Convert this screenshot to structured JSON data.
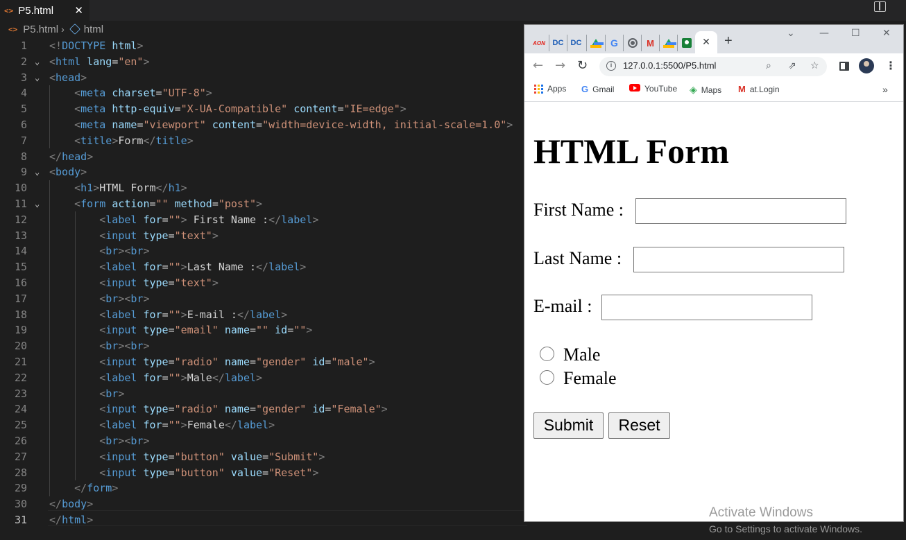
{
  "editor": {
    "tab": {
      "icon": "html-file-icon",
      "label": "P5.html",
      "close": "✕"
    },
    "breadcrumb": {
      "file": "P5.html",
      "symbol": "html"
    },
    "lines": [
      [
        [
          "brk",
          "<!"
        ],
        [
          "tag",
          "DOCTYPE"
        ],
        [
          "txt",
          " "
        ],
        [
          "att",
          "html"
        ],
        [
          "brk",
          ">"
        ]
      ],
      [
        [
          "brk",
          "<"
        ],
        [
          "tag",
          "html"
        ],
        [
          "txt",
          " "
        ],
        [
          "att",
          "lang"
        ],
        [
          "txt",
          "="
        ],
        [
          "str",
          "\"en\""
        ],
        [
          "brk",
          ">"
        ]
      ],
      [
        [
          "brk",
          "<"
        ],
        [
          "tag",
          "head"
        ],
        [
          "brk",
          ">"
        ]
      ],
      [
        [
          "txt",
          "    "
        ],
        [
          "brk",
          "<"
        ],
        [
          "tag",
          "meta"
        ],
        [
          "txt",
          " "
        ],
        [
          "att",
          "charset"
        ],
        [
          "txt",
          "="
        ],
        [
          "str",
          "\"UTF-8\""
        ],
        [
          "brk",
          ">"
        ]
      ],
      [
        [
          "txt",
          "    "
        ],
        [
          "brk",
          "<"
        ],
        [
          "tag",
          "meta"
        ],
        [
          "txt",
          " "
        ],
        [
          "att",
          "http-equiv"
        ],
        [
          "txt",
          "="
        ],
        [
          "str",
          "\"X-UA-Compatible\""
        ],
        [
          "txt",
          " "
        ],
        [
          "att",
          "content"
        ],
        [
          "txt",
          "="
        ],
        [
          "str",
          "\"IE=edge\""
        ],
        [
          "brk",
          ">"
        ]
      ],
      [
        [
          "txt",
          "    "
        ],
        [
          "brk",
          "<"
        ],
        [
          "tag",
          "meta"
        ],
        [
          "txt",
          " "
        ],
        [
          "att",
          "name"
        ],
        [
          "txt",
          "="
        ],
        [
          "str",
          "\"viewport\""
        ],
        [
          "txt",
          " "
        ],
        [
          "att",
          "content"
        ],
        [
          "txt",
          "="
        ],
        [
          "str",
          "\"width=device-width, initial-scale=1.0\""
        ],
        [
          "brk",
          ">"
        ]
      ],
      [
        [
          "txt",
          "    "
        ],
        [
          "brk",
          "<"
        ],
        [
          "tag",
          "title"
        ],
        [
          "brk",
          ">"
        ],
        [
          "txt",
          "Form"
        ],
        [
          "brk",
          "</"
        ],
        [
          "tag",
          "title"
        ],
        [
          "brk",
          ">"
        ]
      ],
      [
        [
          "brk",
          "</"
        ],
        [
          "tag",
          "head"
        ],
        [
          "brk",
          ">"
        ]
      ],
      [
        [
          "brk",
          "<"
        ],
        [
          "tag",
          "body"
        ],
        [
          "brk",
          ">"
        ]
      ],
      [
        [
          "txt",
          "    "
        ],
        [
          "brk",
          "<"
        ],
        [
          "tag",
          "h1"
        ],
        [
          "brk",
          ">"
        ],
        [
          "txt",
          "HTML Form"
        ],
        [
          "brk",
          "</"
        ],
        [
          "tag",
          "h1"
        ],
        [
          "brk",
          ">"
        ]
      ],
      [
        [
          "txt",
          "    "
        ],
        [
          "brk",
          "<"
        ],
        [
          "tag",
          "form"
        ],
        [
          "txt",
          " "
        ],
        [
          "att",
          "action"
        ],
        [
          "txt",
          "="
        ],
        [
          "str",
          "\"\""
        ],
        [
          "txt",
          " "
        ],
        [
          "att",
          "method"
        ],
        [
          "txt",
          "="
        ],
        [
          "str",
          "\"post\""
        ],
        [
          "brk",
          ">"
        ]
      ],
      [
        [
          "txt",
          "        "
        ],
        [
          "brk",
          "<"
        ],
        [
          "tag",
          "label"
        ],
        [
          "txt",
          " "
        ],
        [
          "att",
          "for"
        ],
        [
          "txt",
          "="
        ],
        [
          "str",
          "\"\""
        ],
        [
          "brk",
          ">"
        ],
        [
          "txt",
          " First Name :"
        ],
        [
          "brk",
          "</"
        ],
        [
          "tag",
          "label"
        ],
        [
          "brk",
          ">"
        ]
      ],
      [
        [
          "txt",
          "        "
        ],
        [
          "brk",
          "<"
        ],
        [
          "tag",
          "input"
        ],
        [
          "txt",
          " "
        ],
        [
          "att",
          "type"
        ],
        [
          "txt",
          "="
        ],
        [
          "str",
          "\"text\""
        ],
        [
          "brk",
          ">"
        ]
      ],
      [
        [
          "txt",
          "        "
        ],
        [
          "brk",
          "<"
        ],
        [
          "tag",
          "br"
        ],
        [
          "brk",
          "><"
        ],
        [
          "tag",
          "br"
        ],
        [
          "brk",
          ">"
        ]
      ],
      [
        [
          "txt",
          "        "
        ],
        [
          "brk",
          "<"
        ],
        [
          "tag",
          "label"
        ],
        [
          "txt",
          " "
        ],
        [
          "att",
          "for"
        ],
        [
          "txt",
          "="
        ],
        [
          "str",
          "\"\""
        ],
        [
          "brk",
          ">"
        ],
        [
          "txt",
          "Last Name :"
        ],
        [
          "brk",
          "</"
        ],
        [
          "tag",
          "label"
        ],
        [
          "brk",
          ">"
        ]
      ],
      [
        [
          "txt",
          "        "
        ],
        [
          "brk",
          "<"
        ],
        [
          "tag",
          "input"
        ],
        [
          "txt",
          " "
        ],
        [
          "att",
          "type"
        ],
        [
          "txt",
          "="
        ],
        [
          "str",
          "\"text\""
        ],
        [
          "brk",
          ">"
        ]
      ],
      [
        [
          "txt",
          "        "
        ],
        [
          "brk",
          "<"
        ],
        [
          "tag",
          "br"
        ],
        [
          "brk",
          "><"
        ],
        [
          "tag",
          "br"
        ],
        [
          "brk",
          ">"
        ]
      ],
      [
        [
          "txt",
          "        "
        ],
        [
          "brk",
          "<"
        ],
        [
          "tag",
          "label"
        ],
        [
          "txt",
          " "
        ],
        [
          "att",
          "for"
        ],
        [
          "txt",
          "="
        ],
        [
          "str",
          "\"\""
        ],
        [
          "brk",
          ">"
        ],
        [
          "txt",
          "E-mail :"
        ],
        [
          "brk",
          "</"
        ],
        [
          "tag",
          "label"
        ],
        [
          "brk",
          ">"
        ]
      ],
      [
        [
          "txt",
          "        "
        ],
        [
          "brk",
          "<"
        ],
        [
          "tag",
          "input"
        ],
        [
          "txt",
          " "
        ],
        [
          "att",
          "type"
        ],
        [
          "txt",
          "="
        ],
        [
          "str",
          "\"email\""
        ],
        [
          "txt",
          " "
        ],
        [
          "att",
          "name"
        ],
        [
          "txt",
          "="
        ],
        [
          "str",
          "\"\""
        ],
        [
          "txt",
          " "
        ],
        [
          "att",
          "id"
        ],
        [
          "txt",
          "="
        ],
        [
          "str",
          "\"\""
        ],
        [
          "brk",
          ">"
        ]
      ],
      [
        [
          "txt",
          "        "
        ],
        [
          "brk",
          "<"
        ],
        [
          "tag",
          "br"
        ],
        [
          "brk",
          "><"
        ],
        [
          "tag",
          "br"
        ],
        [
          "brk",
          ">"
        ]
      ],
      [
        [
          "txt",
          "        "
        ],
        [
          "brk",
          "<"
        ],
        [
          "tag",
          "input"
        ],
        [
          "txt",
          " "
        ],
        [
          "att",
          "type"
        ],
        [
          "txt",
          "="
        ],
        [
          "str",
          "\"radio\""
        ],
        [
          "txt",
          " "
        ],
        [
          "att",
          "name"
        ],
        [
          "txt",
          "="
        ],
        [
          "str",
          "\"gender\""
        ],
        [
          "txt",
          " "
        ],
        [
          "att",
          "id"
        ],
        [
          "txt",
          "="
        ],
        [
          "str",
          "\"male\""
        ],
        [
          "brk",
          ">"
        ]
      ],
      [
        [
          "txt",
          "        "
        ],
        [
          "brk",
          "<"
        ],
        [
          "tag",
          "label"
        ],
        [
          "txt",
          " "
        ],
        [
          "att",
          "for"
        ],
        [
          "txt",
          "="
        ],
        [
          "str",
          "\"\""
        ],
        [
          "brk",
          ">"
        ],
        [
          "txt",
          "Male"
        ],
        [
          "brk",
          "</"
        ],
        [
          "tag",
          "label"
        ],
        [
          "brk",
          ">"
        ]
      ],
      [
        [
          "txt",
          "        "
        ],
        [
          "brk",
          "<"
        ],
        [
          "tag",
          "br"
        ],
        [
          "brk",
          ">"
        ]
      ],
      [
        [
          "txt",
          "        "
        ],
        [
          "brk",
          "<"
        ],
        [
          "tag",
          "input"
        ],
        [
          "txt",
          " "
        ],
        [
          "att",
          "type"
        ],
        [
          "txt",
          "="
        ],
        [
          "str",
          "\"radio\""
        ],
        [
          "txt",
          " "
        ],
        [
          "att",
          "name"
        ],
        [
          "txt",
          "="
        ],
        [
          "str",
          "\"gender\""
        ],
        [
          "txt",
          " "
        ],
        [
          "att",
          "id"
        ],
        [
          "txt",
          "="
        ],
        [
          "str",
          "\"Female\""
        ],
        [
          "brk",
          ">"
        ]
      ],
      [
        [
          "txt",
          "        "
        ],
        [
          "brk",
          "<"
        ],
        [
          "tag",
          "label"
        ],
        [
          "txt",
          " "
        ],
        [
          "att",
          "for"
        ],
        [
          "txt",
          "="
        ],
        [
          "str",
          "\"\""
        ],
        [
          "brk",
          ">"
        ],
        [
          "txt",
          "Female"
        ],
        [
          "brk",
          "</"
        ],
        [
          "tag",
          "label"
        ],
        [
          "brk",
          ">"
        ]
      ],
      [
        [
          "txt",
          "        "
        ],
        [
          "brk",
          "<"
        ],
        [
          "tag",
          "br"
        ],
        [
          "brk",
          "><"
        ],
        [
          "tag",
          "br"
        ],
        [
          "brk",
          ">"
        ]
      ],
      [
        [
          "txt",
          "        "
        ],
        [
          "brk",
          "<"
        ],
        [
          "tag",
          "input"
        ],
        [
          "txt",
          " "
        ],
        [
          "att",
          "type"
        ],
        [
          "txt",
          "="
        ],
        [
          "str",
          "\"button\""
        ],
        [
          "txt",
          " "
        ],
        [
          "att",
          "value"
        ],
        [
          "txt",
          "="
        ],
        [
          "str",
          "\"Submit\""
        ],
        [
          "brk",
          ">"
        ]
      ],
      [
        [
          "txt",
          "        "
        ],
        [
          "brk",
          "<"
        ],
        [
          "tag",
          "input"
        ],
        [
          "txt",
          " "
        ],
        [
          "att",
          "type"
        ],
        [
          "txt",
          "="
        ],
        [
          "str",
          "\"button\""
        ],
        [
          "txt",
          " "
        ],
        [
          "att",
          "value"
        ],
        [
          "txt",
          "="
        ],
        [
          "str",
          "\"Reset\""
        ],
        [
          "brk",
          ">"
        ]
      ],
      [
        [
          "txt",
          "    "
        ],
        [
          "brk",
          "</"
        ],
        [
          "tag",
          "form"
        ],
        [
          "brk",
          ">"
        ]
      ],
      [
        [
          "brk",
          "</"
        ],
        [
          "tag",
          "body"
        ],
        [
          "brk",
          ">"
        ]
      ],
      [
        [
          "brk",
          "</"
        ],
        [
          "tag",
          "html"
        ],
        [
          "brk",
          ">"
        ]
      ]
    ],
    "fold_lines": [
      2,
      3,
      9,
      11
    ],
    "active_line": 31
  },
  "browser": {
    "tab_favicons": [
      "aon-icon",
      "dc-icon",
      "dc-icon",
      "google-drive-icon",
      "google-icon",
      "globe-icon",
      "gmail-icon",
      "google-drive-icon",
      "google-classroom-icon"
    ],
    "tab_favicon_text": {
      "aon-icon": "AON",
      "dc-icon": "DC",
      "google-icon": "G",
      "gmail-icon": "M"
    },
    "active_tab_close": "✕",
    "new_tab": "+",
    "url": "127.0.0.1:5500/P5.html",
    "bookmarks": [
      {
        "icon": "apps-grid-icon",
        "label": "Apps"
      },
      {
        "icon": "google-icon",
        "label": "Gmail"
      },
      {
        "icon": "youtube-icon",
        "label": "YouTube"
      },
      {
        "icon": "maps-icon",
        "label": "Maps"
      },
      {
        "icon": "gmail-icon",
        "label": "at.Login"
      }
    ],
    "bookmarks_more": "»",
    "page": {
      "heading": "HTML Form",
      "first_name_label": "First Name :",
      "last_name_label": "Last Name :",
      "email_label": "E-mail :",
      "radio_male_label": "Male",
      "radio_female_label": "Female",
      "submit_label": "Submit",
      "reset_label": "Reset",
      "first_name_value": "",
      "last_name_value": "",
      "email_value": ""
    }
  },
  "watermark": {
    "title": "Activate Windows",
    "subtitle": "Go to Settings to activate Windows."
  }
}
